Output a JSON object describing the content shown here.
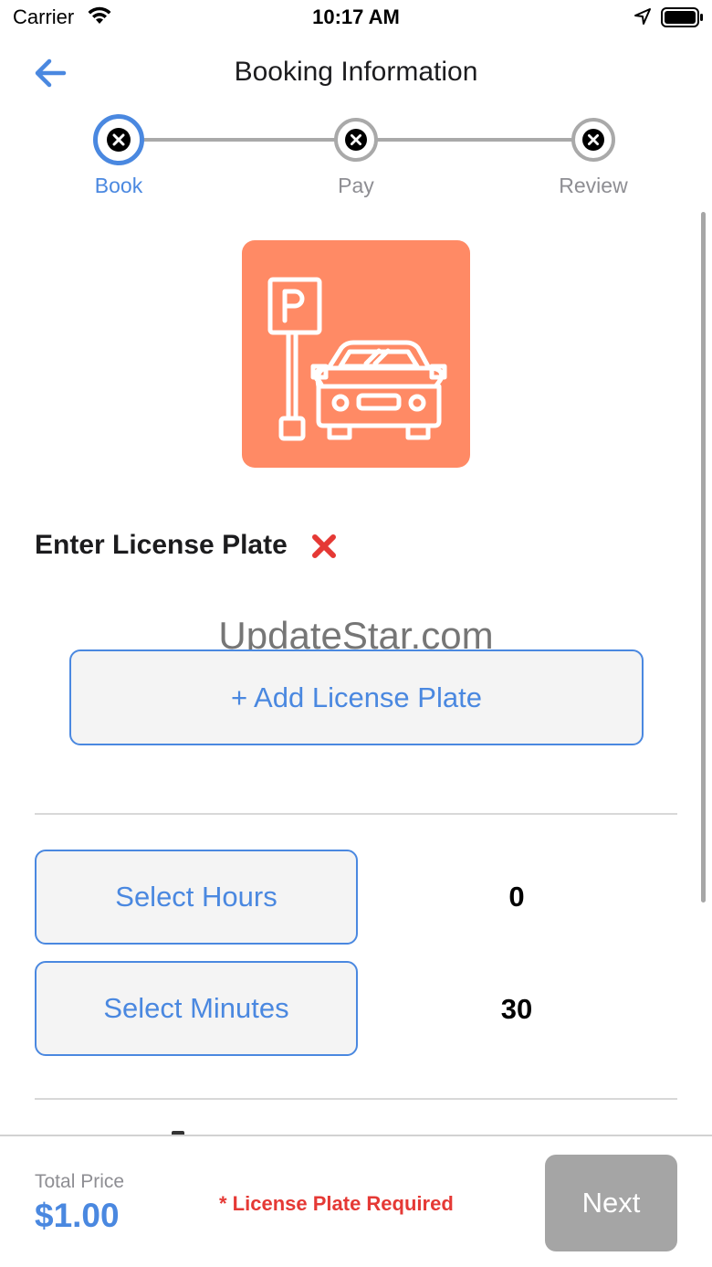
{
  "status_bar": {
    "carrier": "Carrier",
    "time": "10:17 AM"
  },
  "nav": {
    "title": "Booking Information"
  },
  "stepper": {
    "steps": [
      {
        "label": "Book",
        "active": true
      },
      {
        "label": "Pay",
        "active": false
      },
      {
        "label": "Review",
        "active": false
      }
    ]
  },
  "license": {
    "heading": "Enter License Plate",
    "add_button": "+ Add License Plate"
  },
  "watermark": "UpdateStar.com",
  "duration": {
    "hours_label": "Select Hours",
    "hours_value": "0",
    "minutes_label": "Select Minutes",
    "minutes_value": "30"
  },
  "footer": {
    "total_label": "Total Price",
    "total_value": "$1.00",
    "required_message": "* License Plate Required",
    "next_label": "Next"
  },
  "colors": {
    "accent": "#4a88e0",
    "hero_bg": "#ff8a65",
    "error": "#e53935",
    "disabled": "#a5a5a5"
  },
  "icons": {
    "back": "arrow-left-icon",
    "step": "x-circle-icon",
    "hero": "parking-car-icon",
    "status": "red-x-icon"
  }
}
